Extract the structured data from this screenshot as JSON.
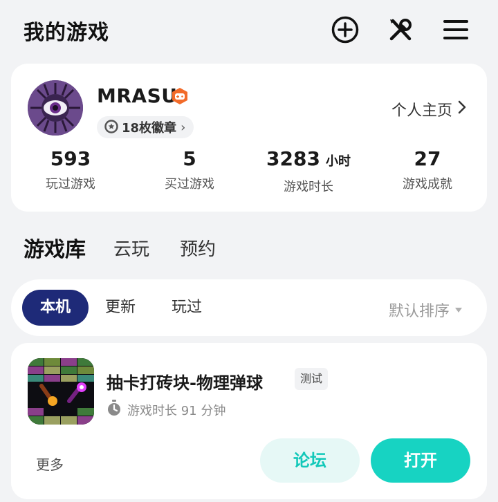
{
  "header": {
    "title": "我的游戏",
    "icons": [
      "add-circle-icon",
      "tools-icon",
      "menu-icon"
    ]
  },
  "profile": {
    "username": "MRASU",
    "vip_icon": "gamepad-badge-icon",
    "badges_label": "18枚徽章",
    "homepage_label": "个人主页",
    "stats": [
      {
        "value": "593",
        "unit": "",
        "label": "玩过游戏"
      },
      {
        "value": "5",
        "unit": "",
        "label": "买过游戏"
      },
      {
        "value": "3283",
        "unit": "小时",
        "label": "游戏时长"
      },
      {
        "value": "27",
        "unit": "",
        "label": "游戏成就"
      }
    ]
  },
  "library_tabs": [
    {
      "label": "游戏库",
      "active": true
    },
    {
      "label": "云玩",
      "active": false
    },
    {
      "label": "预约",
      "active": false
    }
  ],
  "filters": {
    "chips": [
      {
        "label": "本机",
        "active": true
      },
      {
        "label": "更新",
        "active": false
      },
      {
        "label": "玩过",
        "active": false
      }
    ],
    "sort_label": "默认排序"
  },
  "game": {
    "title": "抽卡打砖块-物理弹球",
    "tag": "测试",
    "playtime_label": "游戏时长 91 分钟",
    "more_label": "更多",
    "forum_label": "论坛",
    "open_label": "打开"
  },
  "colors": {
    "accent": "#17d3c2",
    "active_chip": "#1e2a78",
    "vip_orange": "#f26b2a"
  }
}
